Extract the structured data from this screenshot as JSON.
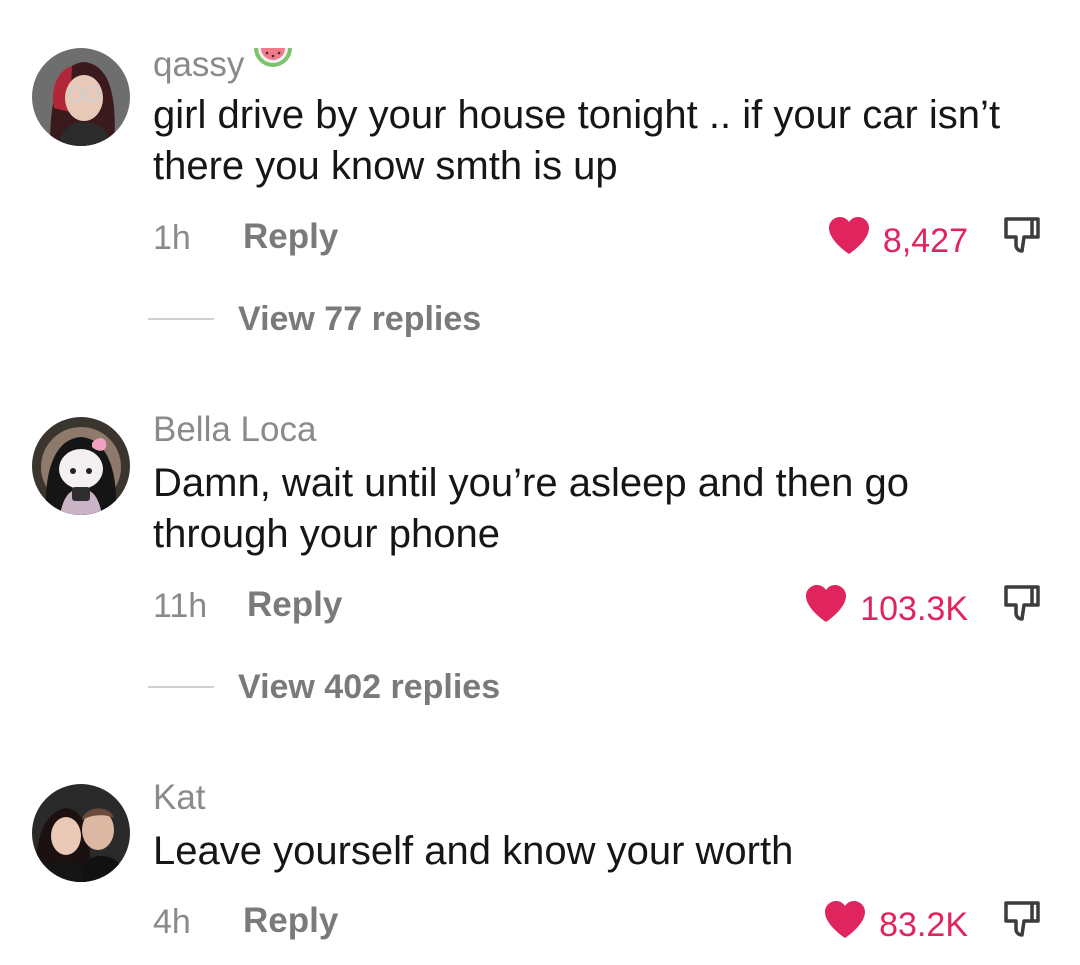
{
  "comments": [
    {
      "username": "qassy",
      "username_icon": "watermelon-emoji",
      "text": "girl drive by your house tonight .. if your car isn’t there you know smth is up",
      "time": "1h",
      "reply_label": "Reply",
      "likes": "8,427",
      "view_replies": "View 77 replies"
    },
    {
      "username": "Bella Loca",
      "text": "Damn, wait until you’re asleep and then go through your phone",
      "time": "11h",
      "reply_label": "Reply",
      "likes": "103.3K",
      "view_replies": "View 402 replies"
    },
    {
      "username": "Kat",
      "text": "Leave yourself and know your worth",
      "time": "4h",
      "reply_label": "Reply",
      "likes": "83.2K"
    }
  ],
  "colors": {
    "like_accent": "#e0245e",
    "secondary_text": "#8a8a8a",
    "primary_text": "#161616"
  }
}
